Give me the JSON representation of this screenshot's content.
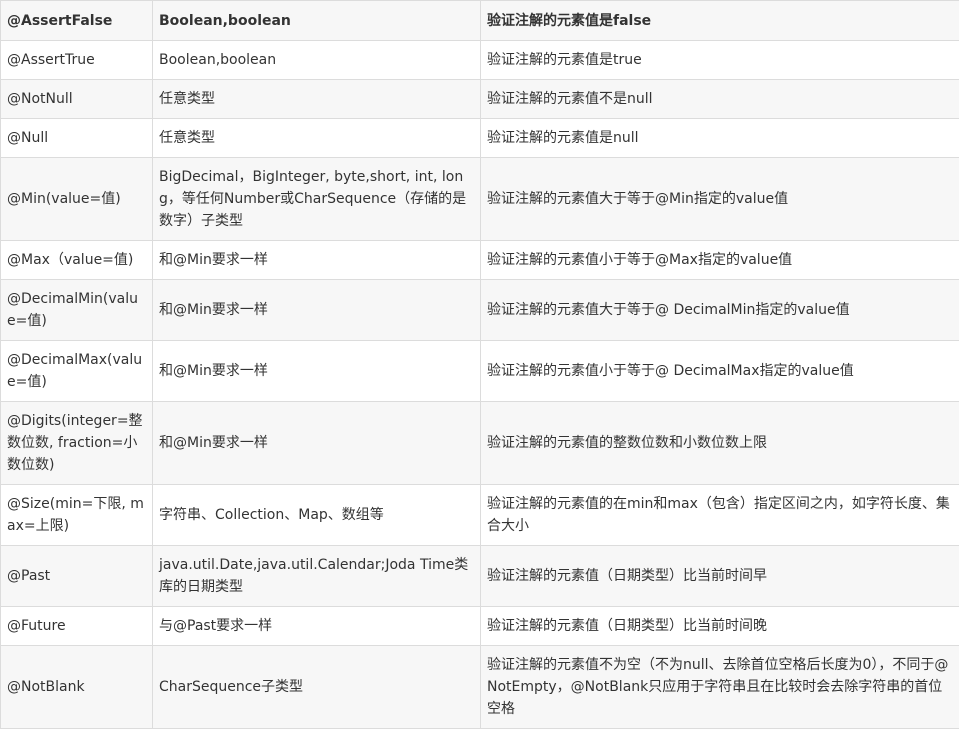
{
  "header": {
    "col1": "@AssertFalse",
    "col2": "Boolean,boolean",
    "col3": "验证注解的元素值是false"
  },
  "rows": [
    {
      "annotation": "@AssertTrue",
      "types": "Boolean,boolean",
      "description": "验证注解的元素值是true"
    },
    {
      "annotation": "@NotNull",
      "types": "任意类型",
      "description": "验证注解的元素值不是null"
    },
    {
      "annotation": "@Null",
      "types": "任意类型",
      "description": "验证注解的元素值是null"
    },
    {
      "annotation": "@Min(value=值)",
      "types": "BigDecimal，BigInteger, byte,short, int, long，等任何Number或CharSequence（存储的是数字）子类型",
      "description": "验证注解的元素值大于等于@Min指定的value值"
    },
    {
      "annotation": "@Max（value=值)",
      "types": "和@Min要求一样",
      "description": "验证注解的元素值小于等于@Max指定的value值"
    },
    {
      "annotation": "@DecimalMin(value=值)",
      "types": "和@Min要求一样",
      "description": "验证注解的元素值大于等于@ DecimalMin指定的value值"
    },
    {
      "annotation": "@DecimalMax(value=值)",
      "types": "和@Min要求一样",
      "description": "验证注解的元素值小于等于@ DecimalMax指定的value值"
    },
    {
      "annotation": "@Digits(integer=整数位数, fraction=小数位数)",
      "types": "和@Min要求一样",
      "description": "验证注解的元素值的整数位数和小数位数上限"
    },
    {
      "annotation": "@Size(min=下限, max=上限)",
      "types": "字符串、Collection、Map、数组等",
      "description": "验证注解的元素值的在min和max（包含）指定区间之内，如字符长度、集合大小"
    },
    {
      "annotation": "@Past",
      "types": "java.util.Date,java.util.Calendar;Joda Time类库的日期类型",
      "description": "验证注解的元素值（日期类型）比当前时间早"
    },
    {
      "annotation": "@Future",
      "types": "与@Past要求一样",
      "description": "验证注解的元素值（日期类型）比当前时间晚"
    },
    {
      "annotation": "@NotBlank",
      "types": "CharSequence子类型",
      "description": "验证注解的元素值不为空（不为null、去除首位空格后长度为0），不同于@NotEmpty，@NotBlank只应用于字符串且在比较时会去除字符串的首位空格"
    }
  ]
}
